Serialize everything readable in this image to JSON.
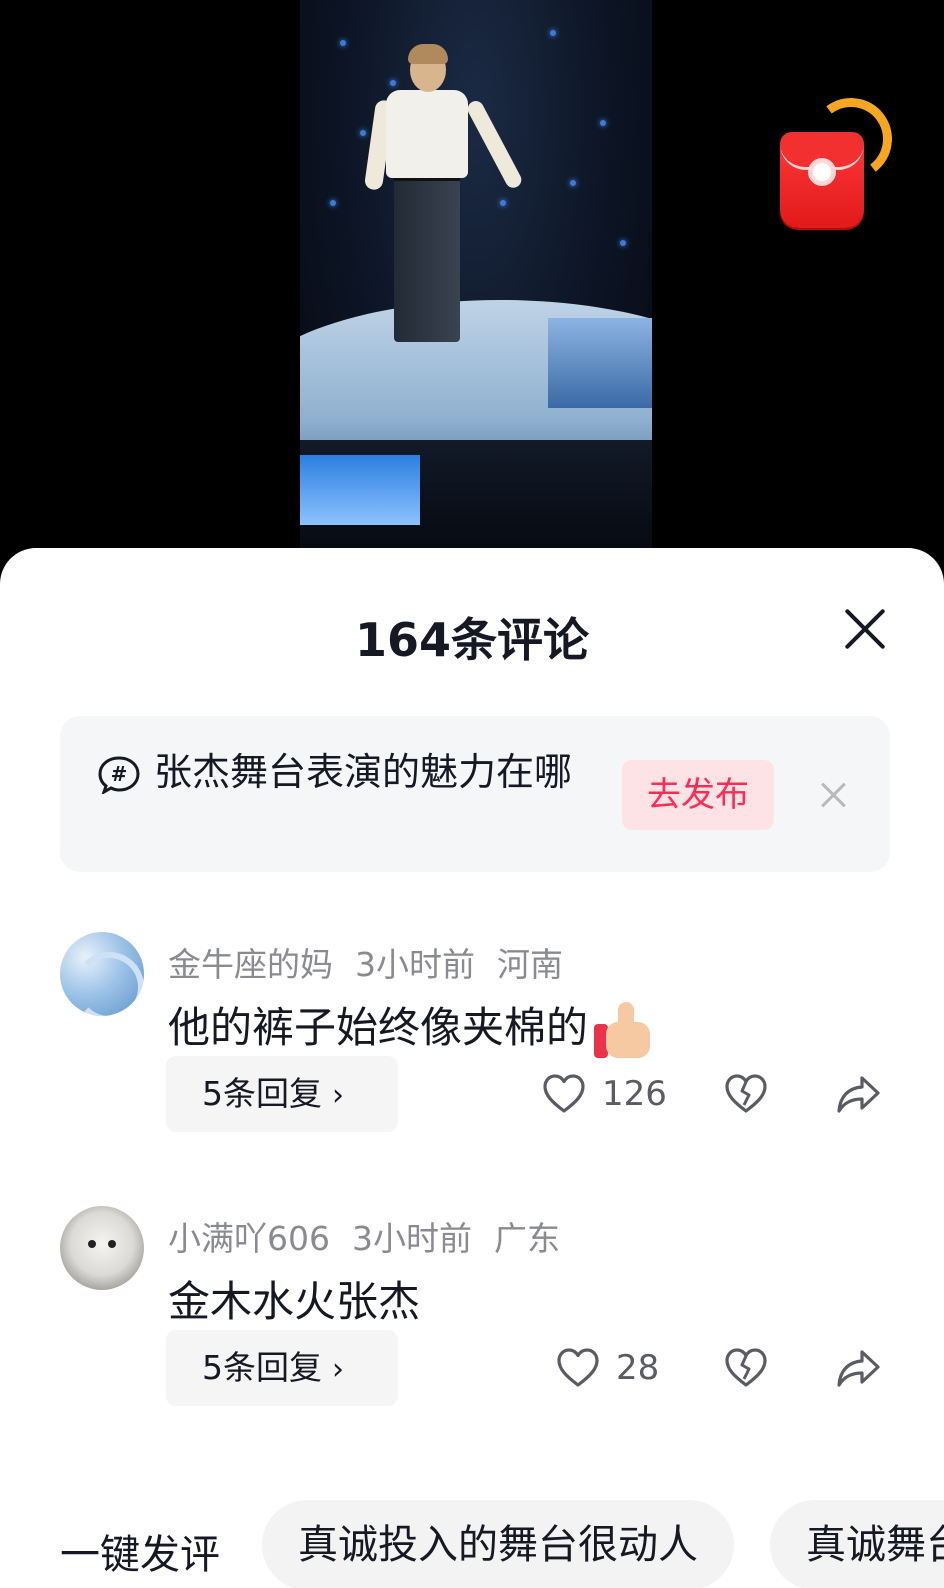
{
  "sheet": {
    "title": "164条评论"
  },
  "topic": {
    "text": "张杰舞台表演的魅力在哪",
    "publish_label": "去发布"
  },
  "comments": [
    {
      "username": "金牛座的妈",
      "time": "3小时前",
      "location": "河南",
      "text": "他的裤子始终像夹棉的",
      "replies_label": "5条回复",
      "likes": "126"
    },
    {
      "username": "小满吖606",
      "time": "3小时前",
      "location": "广东",
      "text": "金木水火张杰",
      "replies_label": "5条回复",
      "likes": "28"
    }
  ],
  "quick_comment": {
    "label": "一键发评",
    "chips": [
      "真诚投入的舞台很动人",
      "真诚舞台"
    ]
  },
  "icons": {
    "close": "close-icon",
    "hashtag": "hashtag-bubble-icon",
    "like": "heart-icon",
    "dislike": "broken-heart-icon",
    "share": "share-arrow-icon",
    "red_packet": "red-packet-icon",
    "thumbs_up_emoji": "thumbs-up-emoji"
  },
  "colors": {
    "accent": "#fe2c55",
    "publish_bg": "#fde3e5",
    "meta_text": "#8a8b91",
    "red_packet": "#e11919",
    "red_packet_arc": "#f5a623"
  }
}
